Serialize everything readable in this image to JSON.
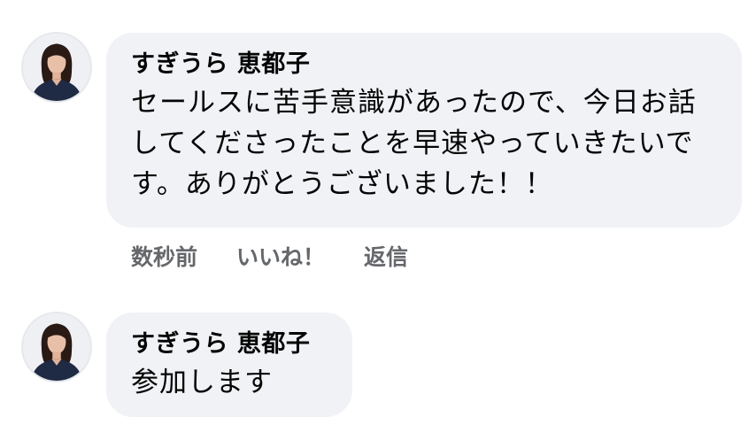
{
  "comments": [
    {
      "author": "すぎうら 恵都子",
      "text": "セールスに苦手意識があったので、今日お話してくださったことを早速やっていきたいです。ありがとうございました！！",
      "actions": {
        "time": "数秒前",
        "like": "いいね！",
        "reply": "返信"
      }
    },
    {
      "author": "すぎうら 恵都子",
      "text": "参加します"
    }
  ],
  "colors": {
    "bubble_bg": "#f0f2f5",
    "action_text": "#65676b",
    "text": "#050505"
  }
}
